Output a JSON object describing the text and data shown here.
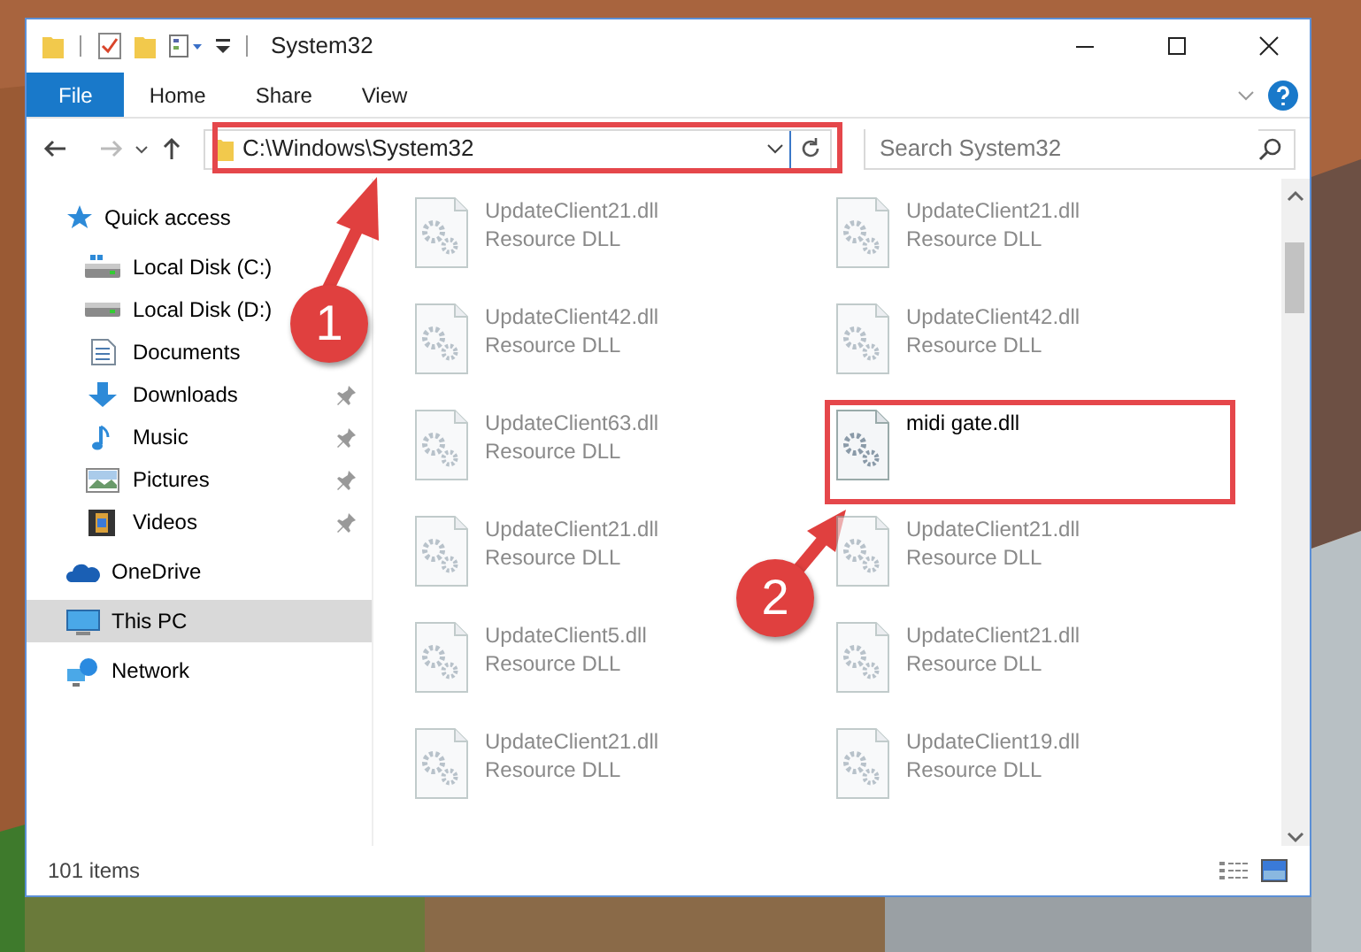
{
  "window": {
    "title": "System32"
  },
  "ribbon_tabs": [
    {
      "label": "File",
      "kind": "file"
    },
    {
      "label": "Home",
      "kind": "tab"
    },
    {
      "label": "Share",
      "kind": "tab"
    },
    {
      "label": "View",
      "kind": "tab"
    }
  ],
  "address_bar": {
    "path": "C:\\Windows\\System32"
  },
  "search": {
    "placeholder": "Search System32"
  },
  "navigation": [
    {
      "label": "Quick access",
      "kind": "group",
      "pinned": false,
      "selected": false
    },
    {
      "label": "Local Disk (C:)",
      "kind": "item",
      "pinned": false,
      "selected": false
    },
    {
      "label": "Local Disk (D:)",
      "kind": "item",
      "pinned": false,
      "selected": false
    },
    {
      "label": "Documents",
      "kind": "item",
      "pinned": false,
      "selected": false
    },
    {
      "label": "Downloads",
      "kind": "item",
      "pinned": true,
      "selected": false
    },
    {
      "label": "Music",
      "kind": "item",
      "pinned": true,
      "selected": false
    },
    {
      "label": "Pictures",
      "kind": "item",
      "pinned": true,
      "selected": false
    },
    {
      "label": "Videos",
      "kind": "item",
      "pinned": true,
      "selected": false
    },
    {
      "label": "OneDrive",
      "kind": "group",
      "pinned": false,
      "selected": false
    },
    {
      "label": "This PC",
      "kind": "group",
      "pinned": false,
      "selected": true
    },
    {
      "label": "Network",
      "kind": "group",
      "pinned": false,
      "selected": false
    }
  ],
  "files": [
    {
      "name": "UpdateClient21.dll",
      "type": "Resource DLL",
      "dimmed": true
    },
    {
      "name": "UpdateClient21.dll",
      "type": "Resource DLL",
      "dimmed": true
    },
    {
      "name": "UpdateClient42.dll",
      "type": "Resource DLL",
      "dimmed": true
    },
    {
      "name": "UpdateClient42.dll",
      "type": "Resource DLL",
      "dimmed": true
    },
    {
      "name": "UpdateClient63.dll",
      "type": "Resource DLL",
      "dimmed": true
    },
    {
      "name": "midi gate.dll",
      "dimmed": false
    },
    {
      "name": "UpdateClient21.dll",
      "type": "Resource DLL",
      "dimmed": true
    },
    {
      "name": "UpdateClient21.dll",
      "type": "Resource DLL",
      "dimmed": true
    },
    {
      "name": "UpdateClient5.dll",
      "type": "Resource DLL",
      "dimmed": true
    },
    {
      "name": "UpdateClient21.dll",
      "type": "Resource DLL",
      "dimmed": true
    },
    {
      "name": "UpdateClient21.dll",
      "type": "Resource DLL",
      "dimmed": true
    },
    {
      "name": "UpdateClient19.dll",
      "type": "Resource DLL",
      "dimmed": true
    }
  ],
  "status_bar": {
    "item_count": "101 items"
  },
  "annotations": [
    {
      "number": "1"
    },
    {
      "number": "2"
    }
  ]
}
